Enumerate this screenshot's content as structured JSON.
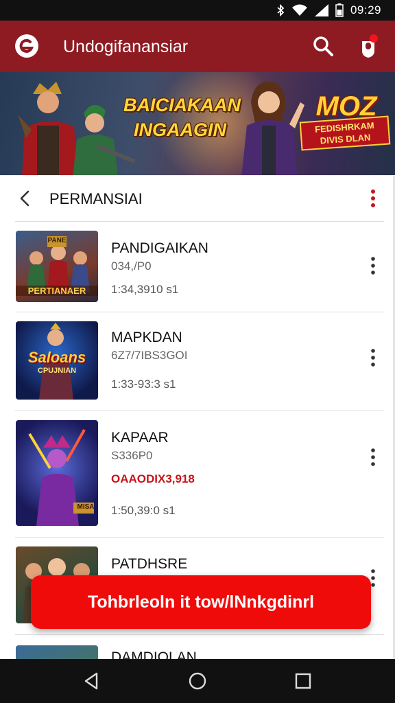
{
  "status_bar": {
    "time": "09:29",
    "icons": [
      "bluetooth-icon",
      "wifi-icon",
      "signal-icon",
      "battery-icon"
    ]
  },
  "app_bar": {
    "title": "Undogifanansiar",
    "icons": [
      "app-logo-icon",
      "search-icon",
      "profile-icon"
    ],
    "accent_color": "#8e1b22"
  },
  "banner": {
    "title_line1": "BAICIAKAAN",
    "title_line2": "INGAAGIN",
    "promo_big": "MOZ",
    "promo_small_line1": "FEDISHRKAM",
    "promo_small_line2": "DIVIS DLAN"
  },
  "section": {
    "title": "PERMANSIAI",
    "icons": [
      "back-arrow-icon",
      "more-vertical-icon"
    ]
  },
  "games": [
    {
      "thumb_label": "PERTIANAER",
      "thumb_badge": "PANE",
      "title": "PANDIGAIKAN",
      "subtitle": "034,/P0",
      "price": "",
      "meta": "1:34,3910 s1"
    },
    {
      "thumb_label": "Saloans",
      "thumb_sub": "CPUJNIAN",
      "title": "MAPKDAN",
      "subtitle": "6Z7/7IBS3GOI",
      "price": "",
      "meta": "1:33-93:3 s1"
    },
    {
      "thumb_label": "",
      "thumb_badge": "MISA",
      "title": "KAPAAR",
      "subtitle": "S336P0",
      "price": "OAAODIX3,918",
      "meta": "1:50,39:0 s1"
    },
    {
      "thumb_label": "",
      "title": "PATDHSRE",
      "subtitle": "",
      "price": "",
      "meta": ""
    },
    {
      "thumb_label": "",
      "title": "DAMDIOLAN",
      "subtitle": "",
      "price": "",
      "meta": ""
    }
  ],
  "cta": {
    "label": "Tohbrleoln it tow/lNnkgdinrl",
    "color": "#f00b0b"
  },
  "nav_bar": {
    "icons": [
      "back-triangle-icon",
      "home-circle-icon",
      "recents-square-icon"
    ]
  }
}
